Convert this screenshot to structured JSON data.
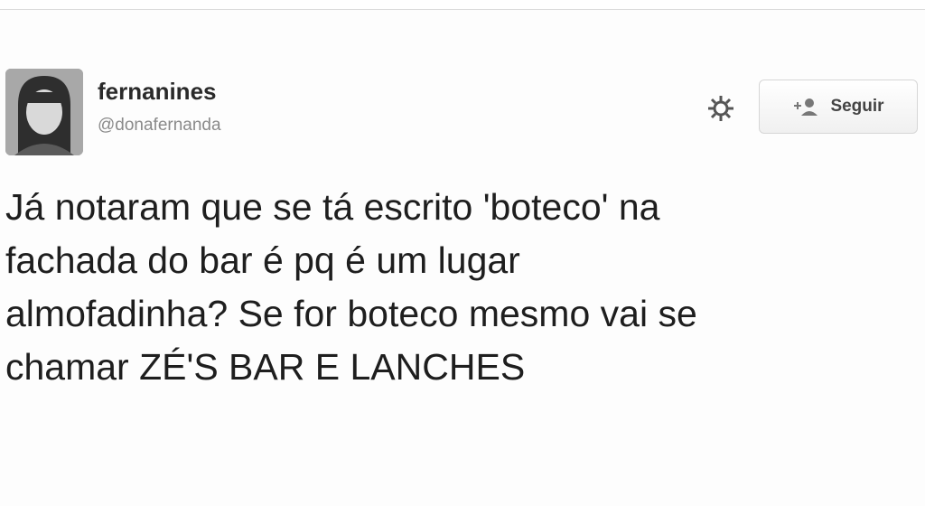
{
  "tweet": {
    "display_name": "fernanines",
    "handle": "@donafernanda",
    "text": "Já notaram que se tá escrito 'boteco' na\nfachada do bar é pq é um lugar\nalmofadinha? Se for boteco mesmo vai se\nchamar ZÉ'S BAR E LANCHES"
  },
  "actions": {
    "settings_icon": "gear-icon",
    "follow_icon": "add-user-icon",
    "follow_label": "Seguir"
  },
  "colors": {
    "text": "#1e1e1e",
    "handle": "#8a8a8a",
    "button_border": "#d6d6d6"
  }
}
